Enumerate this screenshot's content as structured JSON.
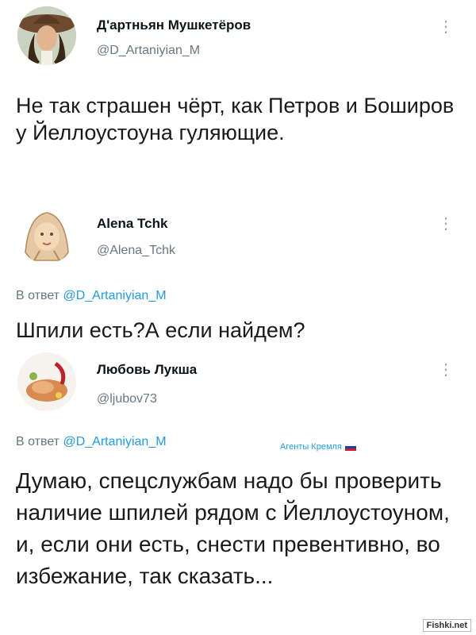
{
  "tweet_main": {
    "display_name": "Д'артньян Мушкетёров",
    "handle": "@D_Artaniyian_M",
    "more_icon": "vertical-dots",
    "text": "Не так страшен чёрт, как Петров и Боширов у Йеллоустоуна гуляющие."
  },
  "reply_1": {
    "display_name": "Alena Tchk",
    "handle": "@Alena_Tchk",
    "more_icon": "vertical-dots",
    "reply_prefix": "В ответ",
    "reply_mention": "@D_Artaniyian_M",
    "text": "Шпили есть?А если найдем?"
  },
  "reply_2": {
    "display_name": "Любовь Лукша",
    "handle": "@ljubov73",
    "more_icon": "vertical-dots",
    "reply_prefix": "В ответ",
    "reply_mention": "@D_Artaniyian_M",
    "caption": "Агенты Кремля",
    "text": "Думаю, спецслужбам надо бы проверить наличие шпилей рядом с Йеллоустоуном, и, если они есть, снести превентивно, во избежание, так сказать..."
  },
  "watermark": "Fishki.net",
  "colors": {
    "link": "#1d9bf0",
    "secondary": "#6b7680",
    "text": "#1a1a1a"
  }
}
